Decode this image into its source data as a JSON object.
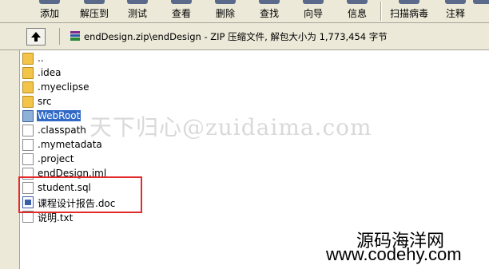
{
  "toolbar": {
    "buttons": [
      {
        "label": "添加",
        "icon": "add-icon"
      },
      {
        "label": "解压到",
        "icon": "extract-icon"
      },
      {
        "label": "测试",
        "icon": "test-icon"
      },
      {
        "label": "查看",
        "icon": "view-icon"
      },
      {
        "label": "删除",
        "icon": "delete-icon"
      },
      {
        "label": "查找",
        "icon": "find-icon"
      },
      {
        "label": "向导",
        "icon": "wizard-icon"
      },
      {
        "label": "信息",
        "icon": "info-icon"
      },
      {
        "label": "扫描病毒",
        "icon": "virus-scan-icon"
      },
      {
        "label": "注释",
        "icon": "comment-icon"
      },
      {
        "label": "",
        "icon": "more-icon"
      }
    ]
  },
  "address": {
    "path": "endDesign.zip\\endDesign - ZIP 压缩文件, 解包大小为 1,773,454 字节",
    "icon": "archive-icon"
  },
  "files": [
    {
      "name": "..",
      "type": "folder",
      "selected": false
    },
    {
      "name": ".idea",
      "type": "folder",
      "selected": false
    },
    {
      "name": ".myeclipse",
      "type": "folder",
      "selected": false
    },
    {
      "name": "src",
      "type": "folder",
      "selected": false
    },
    {
      "name": "WebRoot",
      "type": "folder",
      "selected": true
    },
    {
      "name": ".classpath",
      "type": "file",
      "selected": false
    },
    {
      "name": ".mymetadata",
      "type": "file",
      "selected": false
    },
    {
      "name": ".project",
      "type": "file",
      "selected": false
    },
    {
      "name": "endDesign.iml",
      "type": "file",
      "selected": false
    },
    {
      "name": "student.sql",
      "type": "file",
      "selected": false
    },
    {
      "name": "课程设计报告.doc",
      "type": "doc",
      "selected": false
    },
    {
      "name": "说明.txt",
      "type": "file",
      "selected": false
    }
  ],
  "watermark": "天下归心@zuidaima.com",
  "brand": {
    "name": "源码海洋网",
    "url": "www.codehy.com"
  },
  "colors": {
    "selection": "#316ac5",
    "highlight_border": "#e32b2b",
    "folder": "#f3c44a"
  }
}
